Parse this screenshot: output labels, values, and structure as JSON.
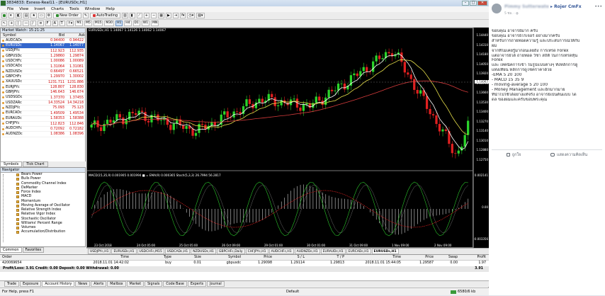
{
  "window": {
    "title": "3834833: Exness-Real11 - [EURUSDc,H1]"
  },
  "menu": [
    "File",
    "View",
    "Insert",
    "Charts",
    "Tools",
    "Window",
    "Help"
  ],
  "toolbar": {
    "new_order": "New Order",
    "autotrading": "AutoTrading",
    "timeframes": [
      "M1",
      "M5",
      "M15",
      "M30",
      "H1",
      "H4",
      "D1",
      "W1",
      "MN"
    ],
    "active_timeframe": "H1"
  },
  "market_watch": {
    "title": "Market Watch: 15:21:25",
    "col_symbol": "Symbol",
    "col_bid": "Bid",
    "col_ask": "Ask",
    "rows": [
      {
        "symbol": "AUDCADc",
        "bid": "0.94400",
        "ask": "0.94422"
      },
      {
        "symbol": "EURUSDc",
        "bid": "1.14067",
        "ask": "1.14077"
      },
      {
        "symbol": "USDJPYc",
        "bid": "112.923",
        "ask": "112.935"
      },
      {
        "symbol": "GBPUSDc",
        "bid": "1.29860",
        "ask": "1.29874"
      },
      {
        "symbol": "USDCHFc",
        "bid": "1.00086",
        "ask": "1.00089"
      },
      {
        "symbol": "USDCADc",
        "bid": "1.31064",
        "ask": "1.31081"
      },
      {
        "symbol": "NZDUSDc",
        "bid": "0.66497",
        "ask": "0.66521"
      },
      {
        "symbol": "GBPCHFc",
        "bid": "1.29970",
        "ask": "1.30002"
      },
      {
        "symbol": "XAUUSDc",
        "bid": "1231.711",
        "ask": "1231.886"
      },
      {
        "symbol": "EURJPYc",
        "bid": "128.807",
        "ask": "128.830"
      },
      {
        "symbol": "GBPJPYc",
        "bid": "146.643",
        "ask": "146.674"
      },
      {
        "symbol": "USDSGDc",
        "bid": "1.37370",
        "ask": "1.37455"
      },
      {
        "symbol": "USDZARc",
        "bid": "14.33524",
        "ask": "14.34218"
      },
      {
        "symbol": "NZDJPYc",
        "bid": "75.093",
        "ask": "75.123"
      },
      {
        "symbol": "EURCADc",
        "bid": "1.49509",
        "ask": "1.49534"
      },
      {
        "symbol": "EURAUDc",
        "bid": "1.58353",
        "ask": "1.58388"
      },
      {
        "symbol": "CHFJPYc",
        "bid": "112.823",
        "ask": "112.846"
      },
      {
        "symbol": "AUDCHFc",
        "bid": "0.72092",
        "ask": "0.72182"
      },
      {
        "symbol": "AUDNZDc",
        "bid": "1.08386",
        "ask": "1.08396"
      }
    ],
    "tabs": [
      "Symbols",
      "Tick Chart"
    ]
  },
  "navigator": {
    "title": "Navigator",
    "items": [
      "Bears Power",
      "Bulls Power",
      "Commodity Channel Index",
      "DeMarker",
      "Force Index",
      "MACD",
      "Momentum",
      "Moving Average of Oscillator",
      "Relative Strength Index",
      "Relative Vigor Index",
      "Stochastic Oscillator",
      "Williams' Percent Range",
      "Volumes",
      "Accumulation/Distribution"
    ],
    "tabs": [
      "Common",
      "Favorites"
    ]
  },
  "chart": {
    "title": "EURUSDc,H1  1.14067 1.14126 1.14062 1.14067",
    "macd_label": "MACD(15,35,9) 0.001905 0.001994  ■ = EMA(9) 0.000365  Stoch(5,3,3) 26.7994 56.2817",
    "price_ticks": [
      "1.14440",
      "1.14310",
      "1.14180",
      "1.14050",
      "1.13920",
      "1.13790",
      "1.13660",
      "1.13530",
      "1.13400",
      "1.13270",
      "1.13140",
      "1.13010",
      "1.12880",
      "1.12750"
    ],
    "current_price": "1.14067",
    "macd_ticks": [
      "0.002141",
      "0.00",
      "-0.003356"
    ],
    "time_ticks": [
      "23 Oct 2018",
      "24 Oct 05:00",
      "25 Oct 05:00",
      "26 Oct 09:00",
      "29 Oct 01:00",
      "30 Oct 01:00",
      "31 Oct 09:00",
      "1 Nov 09:00",
      "2 Nov 09:00"
    ],
    "tabs": [
      "USDJPYc,H1",
      "EURUSDc,H1",
      "USDCHFc,M15",
      "USDCADc,H1",
      "NZDUSDc,H1",
      "GBPCHFc,Daily",
      "CHFJPYc,H1",
      "AUDCHFc,H1",
      "AUDNZDc,H1",
      "EURAUDc,H1",
      "EURCADc,H1",
      "EURUSDc,H1"
    ],
    "active_tab": 11
  },
  "terminal": {
    "headers": [
      "Order",
      "Time",
      "Type",
      "Size",
      "Symbol",
      "Price",
      "S / L",
      "T / P",
      "Time",
      "Price",
      "Swap",
      "Profit"
    ],
    "row": [
      "420069654",
      "2018.11.01 14:42:02",
      "buy",
      "0.01",
      "gbpusdc",
      "1.29098",
      "1.29114",
      "1.29813",
      "2018.11.01 15:44:05",
      "1.29587",
      "0.00",
      "1.97"
    ],
    "summary_left": "Profit/Loss: 3.91  Credit: 0.00  Deposit: 0.00  Withdrawal: 0.00",
    "summary_right": "3.91",
    "tabs": [
      "Trade",
      "Exposure",
      "Account History",
      "News",
      "Alerts",
      "Mailbox",
      "Market",
      "Signals",
      "Code Base",
      "Experts",
      "Journal"
    ],
    "active_tab": "Account History"
  },
  "status": {
    "help": "For Help, press F1",
    "profile": "Default",
    "traffic": "6580/6 kb"
  },
  "post": {
    "author_blurred": "Pimmy Sutterwate",
    "author_visible": "Rojer CmFx",
    "time": "5 ชม.",
    "lines": [
      "ขอบคุณ อาจารย์มาก ครับ",
      "ขอบคุณ อาจารย์โรเจอร์ อย่างมากครับ",
      "สำหรับการถ่ายทอดความรู้ และประสบการณ์ให้กับ",
      "ผม",
      "จากที่ไม่เคยรู้มาก่อนเลยถึง การเทรด Forex",
      "แต่อาจารย์ได้ ถ่ายทอด วิชา สถิติ ในการเทรดหุ้น",
      "Forex",
      "และ เทคนิคการเข้า ในรูปแบบต่างๆ ทั้งหลักการดู",
      "แท่งเทียน หลักการดูโซคราคาด้วย",
      "-EMA 5 20 100",
      "- MACD 15 35 9",
      "- moving-average 5 20 100",
      "- Money Management และอีกมากมาย",
      "ที่นำไปใช้ได้อย่างแท้จริง อาจารย์เป็นต้นแบบ ได",
      "ดล ของผมและครับขอบพระคุณ"
    ],
    "like_label": "ถูกใจ",
    "comment_label": "แสดงความคิดเห็น"
  }
}
